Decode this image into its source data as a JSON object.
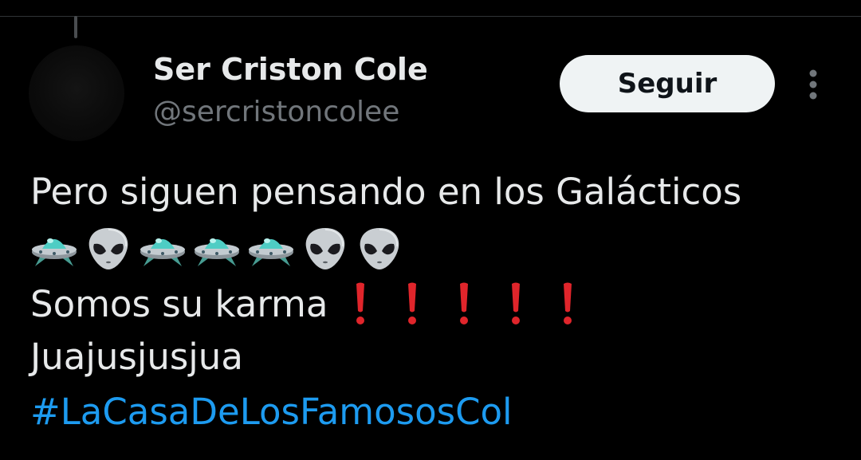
{
  "tweet": {
    "author": {
      "name": "Ser Criston Cole",
      "handle": "@sercristoncolee"
    },
    "follow_button_label": "Seguir",
    "lines": {
      "line1": "Pero siguen pensando en los Galácticos",
      "line3": "Somos su karma",
      "line4": "Juajusjusjua"
    },
    "emoji_row": [
      "flying-saucer",
      "alien",
      "flying-saucer",
      "flying-saucer",
      "flying-saucer",
      "alien",
      "alien"
    ],
    "exclamation_count": 5,
    "hashtag": "#LaCasaDeLosFamososCol"
  },
  "colors": {
    "background": "#000000",
    "text": "#e7e9ea",
    "secondary_text": "#71767b",
    "link": "#1d9bf0",
    "follow_button_bg": "#eff3f4",
    "exclamation": "#e0252b"
  }
}
